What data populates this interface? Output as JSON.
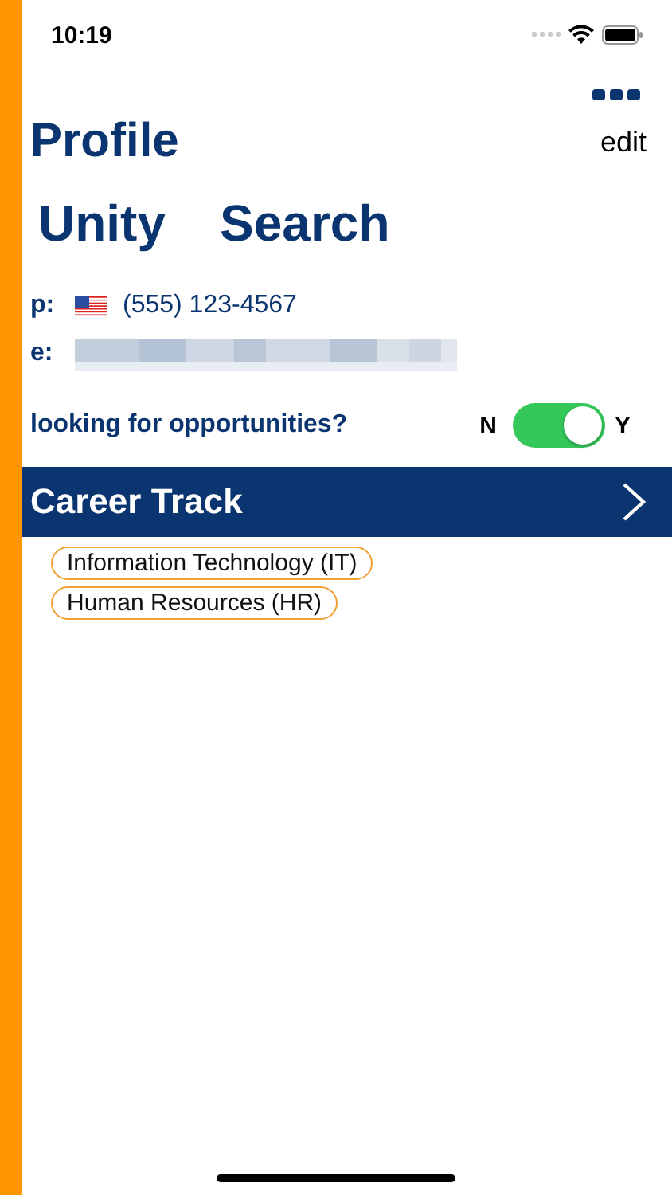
{
  "status_bar": {
    "time": "10:19"
  },
  "header": {
    "title": "Profile",
    "edit": "edit"
  },
  "name": {
    "first": "Unity",
    "last": "Search"
  },
  "contact": {
    "phone_label": "p:",
    "phone": "(555) 123-4567",
    "email_label": "e:",
    "email_redacted": true
  },
  "opportunities": {
    "question": "looking for opportunities?",
    "off_label": "N",
    "on_label": "Y",
    "on": true
  },
  "career_track": {
    "title": "Career Track",
    "tags": [
      "Information Technology (IT)",
      "Human Resources (HR)"
    ]
  }
}
